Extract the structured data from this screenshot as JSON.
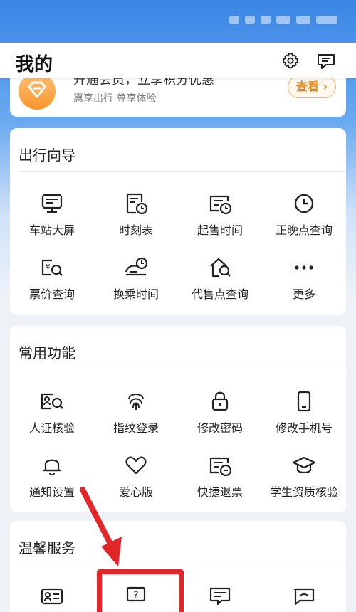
{
  "header": {
    "title": "我的"
  },
  "member": {
    "title": "开通会员，立享积分优惠",
    "subtitle": "惠享出行 尊享体验",
    "button": "查看"
  },
  "travel": {
    "title": "出行向导",
    "items": [
      {
        "label": "车站大屏",
        "icon": "station-screen-icon"
      },
      {
        "label": "时刻表",
        "icon": "timetable-icon"
      },
      {
        "label": "起售时间",
        "icon": "sale-time-icon"
      },
      {
        "label": "正晚点查询",
        "icon": "clock-icon"
      },
      {
        "label": "票价查询",
        "icon": "fare-search-icon"
      },
      {
        "label": "换乘时间",
        "icon": "transfer-time-icon"
      },
      {
        "label": "代售点查询",
        "icon": "agency-search-icon"
      },
      {
        "label": "更多",
        "icon": "more-icon"
      }
    ]
  },
  "common": {
    "title": "常用功能",
    "items": [
      {
        "label": "人证核验",
        "icon": "id-verify-icon"
      },
      {
        "label": "指纹登录",
        "icon": "fingerprint-icon"
      },
      {
        "label": "修改密码",
        "icon": "lock-icon"
      },
      {
        "label": "修改手机号",
        "icon": "phone-icon"
      },
      {
        "label": "通知设置",
        "icon": "bell-icon"
      },
      {
        "label": "爱心版",
        "icon": "heart-icon"
      },
      {
        "label": "快捷退票",
        "icon": "refund-ticket-icon"
      },
      {
        "label": "学生资质核验",
        "icon": "graduation-cap-icon"
      }
    ]
  },
  "service": {
    "title": "温馨服务",
    "items": [
      {
        "icon": "id-card-icon"
      },
      {
        "icon": "help-question-icon"
      },
      {
        "icon": "message-icon"
      },
      {
        "icon": "feedback-icon"
      }
    ]
  },
  "colors": {
    "accent_red": "#e1272a",
    "brand_blue": "#3a86e6",
    "member_orange": "#f7952b"
  }
}
